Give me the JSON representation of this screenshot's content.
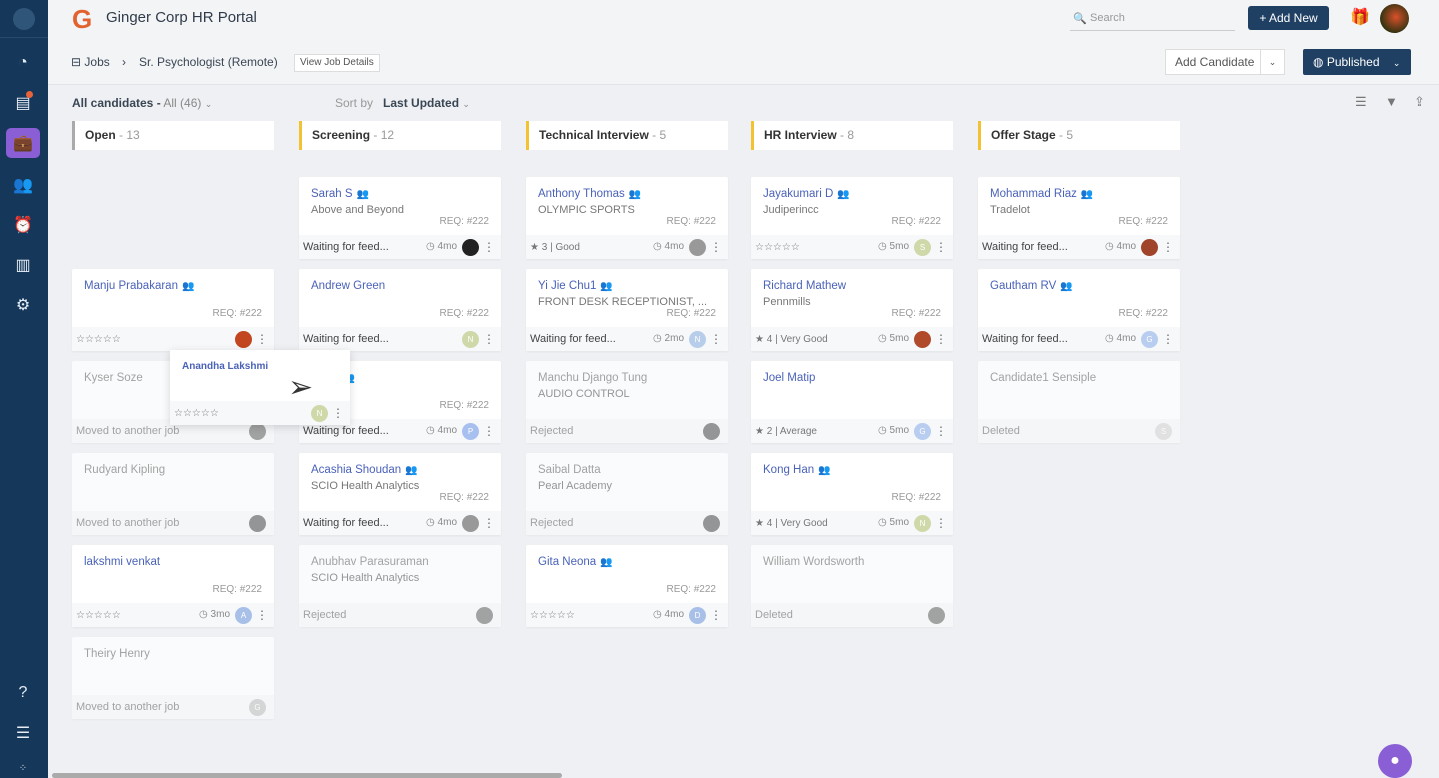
{
  "app": {
    "title": "Ginger Corp HR Portal",
    "logo": "G"
  },
  "topbar": {
    "search_placeholder": "Search",
    "add_new": "+ Add New"
  },
  "breadcrumb": {
    "root": "Jobs",
    "job": "Sr. Psychologist (Remote)",
    "view_details": "View Job Details"
  },
  "actions": {
    "add_candidate": "Add Candidate",
    "published": "Published"
  },
  "filter": {
    "label": "All candidates -",
    "value": "All",
    "count": "(46)",
    "sort_label": "Sort by",
    "sort_value": "Last Updated"
  },
  "colors": {
    "sidebar": "#15375a",
    "accent": "#8a5fd6",
    "primary": "#1f3f63",
    "name": "#4a62b8"
  },
  "columns": [
    {
      "title": "Open",
      "count": "13",
      "color": "#aaaaaa",
      "cards": [
        null,
        {
          "name": "Manju Prabakaran",
          "flag": true,
          "req": "REQ: #222",
          "rating": "☆☆☆☆☆",
          "avatar": "photo",
          "avcolor": "#c2461f"
        },
        {
          "name": "Kyser Soze",
          "inactive": true,
          "status": "Moved to another job",
          "avatar": "photo",
          "avcolor": "#888"
        },
        {
          "name": "Rudyard Kipling",
          "inactive": true,
          "status": "Moved to another job",
          "avatar": "photo",
          "avcolor": "#777"
        },
        {
          "name": "lakshmi venkat",
          "req": "REQ: #222",
          "rating": "☆☆☆☆☆",
          "time": "3mo",
          "avatar": "A",
          "avcolor": "#a8c0e8"
        },
        {
          "name": "Theiry Henry",
          "inactive": true,
          "status": "Moved to another job",
          "avatar": "G",
          "avcolor": "#ccc"
        }
      ]
    },
    {
      "title": "Screening",
      "count": "12",
      "color": "#f2c230",
      "cards": [
        {
          "name": "Sarah S",
          "flag": true,
          "sub": "Above and Beyond",
          "req": "REQ: #222",
          "status": "Waiting for feed...",
          "time": "4mo",
          "avatar": "photo",
          "avcolor": "#222"
        },
        {
          "name": "Andrew Green",
          "req": "REQ: #222",
          "status": "Waiting for feed...",
          "avatar": "N",
          "avcolor": "#cfd8a8"
        },
        {
          "name": "Peter",
          "flag": true,
          "req": "REQ: #222",
          "status": "Waiting for feed...",
          "time": "4mo",
          "avatar": "P",
          "avcolor": "#a8c0f0"
        },
        {
          "name": "Acashia Shoudan",
          "flag": true,
          "sub": "SCIO Health Analytics",
          "req": "REQ: #222",
          "status": "Waiting for feed...",
          "time": "4mo",
          "avatar": "photo",
          "avcolor": "#999"
        },
        {
          "name": "Anubhav Parasuraman",
          "inactive": true,
          "sub": "SCIO Health Analytics",
          "status": "Rejected",
          "avatar": "photo",
          "avcolor": "#888"
        }
      ]
    },
    {
      "title": "Technical Interview",
      "count": "5",
      "color": "#f2c230",
      "cards": [
        {
          "name": "Anthony Thomas",
          "flag": true,
          "sub": "OLYMPIC SPORTS",
          "req": "REQ: #222",
          "rating": "★ 3 | Good",
          "time": "4mo",
          "avatar": "photo",
          "avcolor": "#999"
        },
        {
          "name": "Yi Jie Chu1",
          "flag": true,
          "sub": "FRONT DESK RECEPTIONIST, ...",
          "req": "REQ: #222",
          "status": "Waiting for feed...",
          "time": "2mo",
          "avatar": "N",
          "avcolor": "#b8cdea"
        },
        {
          "name": "Manchu Django Tung",
          "inactive": true,
          "sub": "AUDIO CONTROL",
          "status": "Rejected",
          "avatar": "photo",
          "avcolor": "#777"
        },
        {
          "name": "Saibal Datta",
          "inactive": true,
          "sub": "Pearl Academy",
          "status": "Rejected",
          "avatar": "photo",
          "avcolor": "#777"
        },
        {
          "name": "Gita Neona",
          "flag": true,
          "req": "REQ: #222",
          "rating": "☆☆☆☆☆",
          "time": "4mo",
          "avatar": "D",
          "avcolor": "#a8c0e8"
        }
      ]
    },
    {
      "title": "HR Interview",
      "count": "8",
      "color": "#f2c230",
      "cards": [
        {
          "name": "Jayakumari D",
          "flag": true,
          "sub": "Judiperincc",
          "req": "REQ: #222",
          "rating": "☆☆☆☆☆",
          "time": "5mo",
          "avatar": "S",
          "avcolor": "#cfd8a8"
        },
        {
          "name": "Richard Mathew",
          "sub": "Pennmills",
          "req": "REQ: #222",
          "rating": "★ 4 | Very Good",
          "time": "5mo",
          "avatar": "photo",
          "avcolor": "#b04a2a"
        },
        {
          "name": "Joel Matip",
          "rating": "★ 2 | Average",
          "time": "5mo",
          "avatar": "G",
          "avcolor": "#b8cdf0"
        },
        {
          "name": "Kong Han",
          "flag": true,
          "req": "REQ: #222",
          "rating": "★ 4 | Very Good",
          "time": "5mo",
          "avatar": "N",
          "avcolor": "#cfd8a8"
        },
        {
          "name": "William Wordsworth",
          "inactive": true,
          "status": "Deleted",
          "avatar": "photo",
          "avcolor": "#888"
        }
      ]
    },
    {
      "title": "Offer Stage",
      "count": "5",
      "color": "#f2c230",
      "cards": [
        {
          "name": "Mohammad Riaz",
          "flag": true,
          "sub": "Tradelot",
          "req": "REQ: #222",
          "status": "Waiting for feed...",
          "time": "4mo",
          "avatar": "photo",
          "avcolor": "#a0442a"
        },
        {
          "name": "Gautham RV",
          "flag": true,
          "req": "REQ: #222",
          "status": "Waiting for feed...",
          "time": "4mo",
          "avatar": "G",
          "avcolor": "#b8cdf0"
        },
        {
          "name": "Candidate1 Sensiple",
          "inactive": true,
          "status": "Deleted",
          "avatar": "S",
          "avcolor": "#ddd"
        }
      ]
    }
  ],
  "dragging": {
    "name": "Anandha Lakshmi",
    "rating": "☆☆☆☆☆",
    "avatar": "N"
  }
}
